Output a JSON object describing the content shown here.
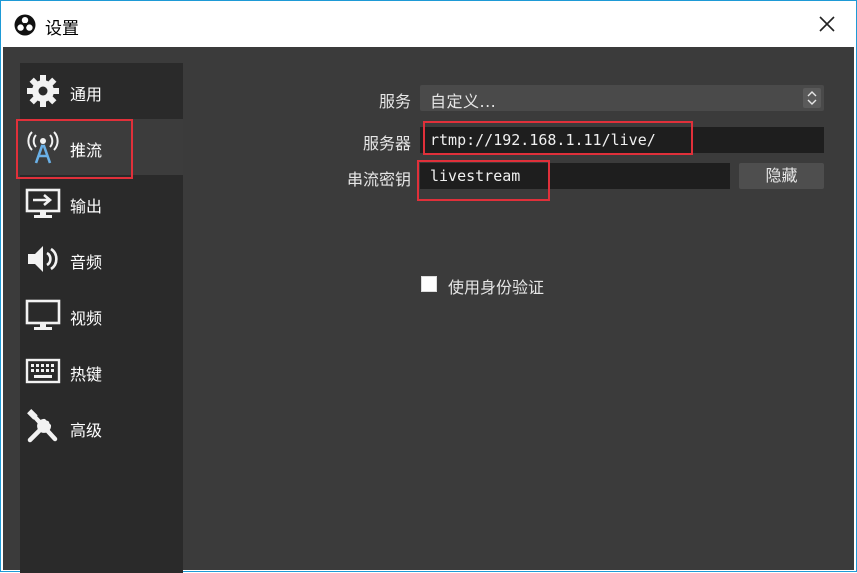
{
  "window": {
    "title": "设置",
    "close_icon": "close-icon",
    "app_icon": "obs-logo-icon",
    "border_color": "#1e9ad6"
  },
  "sidebar": {
    "items": [
      {
        "label": "通用",
        "icon": "gear-icon",
        "active": false
      },
      {
        "label": "推流",
        "icon": "broadcast-antenna-icon",
        "active": true
      },
      {
        "label": "输出",
        "icon": "output-monitor-icon",
        "active": false
      },
      {
        "label": "音频",
        "icon": "speaker-icon",
        "active": false
      },
      {
        "label": "视频",
        "icon": "monitor-icon",
        "active": false
      },
      {
        "label": "热键",
        "icon": "keyboard-icon",
        "active": false
      },
      {
        "label": "高级",
        "icon": "tools-icon",
        "active": false
      }
    ]
  },
  "stream": {
    "service_label": "服务",
    "service_value": "自定义...",
    "server_label": "服务器",
    "server_value": "rtmp://192.168.1.11/live/",
    "key_label": "串流密钥",
    "key_value": "livestream",
    "hide_button": "隐藏",
    "auth_label": "使用身份验证",
    "auth_checked": false
  },
  "colors": {
    "highlight": "#e0303a",
    "panel_bg": "#3b3b3b",
    "sidebar_bg": "#2a2a2a",
    "field_bg": "#1e1e1e"
  }
}
